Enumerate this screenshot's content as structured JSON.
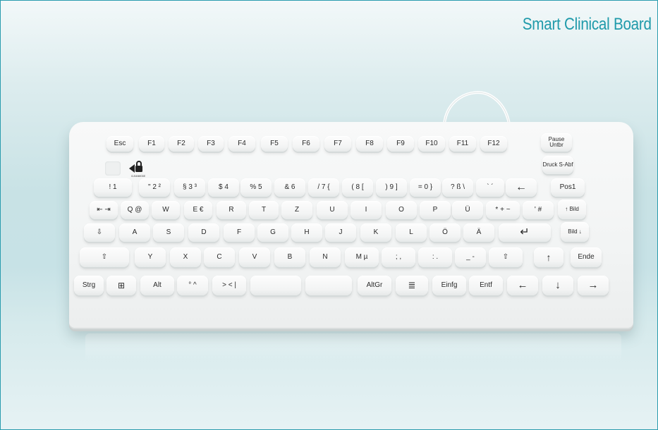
{
  "title": "Smart Clinical Board",
  "colors": {
    "title": "#1f9aaa",
    "border": "#2a9cae"
  },
  "logo_icon": "lock-logo-icon",
  "logo_text": "CLEANMODE",
  "keys": {
    "r1": [
      "Esc",
      "F1",
      "F2",
      "F3",
      "F4",
      "F5",
      "F6",
      "F7",
      "F8",
      "F9",
      "F10",
      "F11",
      "F12",
      "Pause Untbr"
    ],
    "r1b": "Druck S-Abf",
    "r2": [
      "! 1",
      "\" 2 ²",
      "§ 3 ³",
      "$ 4",
      "% 5",
      "& 6",
      "/ 7 {",
      "( 8 [",
      ") 9 ]",
      "= 0 }",
      "? ß \\",
      "` ´",
      "←",
      "Pos1"
    ],
    "r3": [
      "⇤ ⇥",
      "Q @",
      "W",
      "E €",
      "R",
      "T",
      "Z",
      "U",
      "I",
      "O",
      "P",
      "Ü",
      "* + ~",
      "' #",
      "↑ Bild"
    ],
    "r4": [
      "⇩",
      "A",
      "S",
      "D",
      "F",
      "G",
      "H",
      "J",
      "K",
      "L",
      "Ö",
      "Ä",
      "↵",
      "Bild ↓"
    ],
    "r5": [
      "⇧",
      "Y",
      "X",
      "C",
      "V",
      "B",
      "N",
      "M µ",
      ";  ,",
      ":  .",
      "_  -",
      "⇧",
      "↑",
      "Ende"
    ],
    "r6": [
      "Strg",
      "⊞",
      "Alt",
      "° ^",
      "> <  |",
      "",
      "",
      "AltGr",
      "≣",
      "Einfg",
      "Entf",
      "←",
      "↓",
      "→"
    ]
  }
}
